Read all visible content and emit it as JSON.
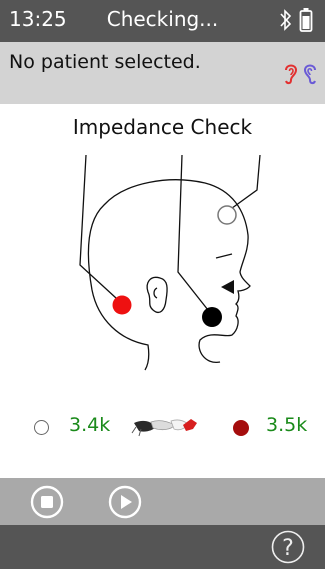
{
  "status_bar": {
    "time": "13:25",
    "title": "Checking...",
    "icons": [
      "bluetooth-icon",
      "battery-icon"
    ]
  },
  "patient": {
    "label": "No patient selected.",
    "icons": [
      "left-ear-icon",
      "right-ear-icon"
    ],
    "colors": {
      "left_ear": "#e23030",
      "right_ear": "#6a5ad6"
    }
  },
  "main": {
    "title": "Impedance Check",
    "electrodes": [
      {
        "position": "top-of-head",
        "status": "white"
      },
      {
        "position": "behind-ear",
        "status": "red"
      },
      {
        "position": "jaw",
        "status": "black"
      }
    ]
  },
  "readings": {
    "left_value": "3.4k",
    "right_value": "3.5k",
    "colors": {
      "value_text": "#1a8a1a",
      "right_dot": "#a50d0d"
    }
  },
  "controls": {
    "icons": [
      "stop-icon",
      "play-icon"
    ]
  },
  "footer": {
    "icons": [
      "help-icon"
    ],
    "help_label": "?"
  }
}
